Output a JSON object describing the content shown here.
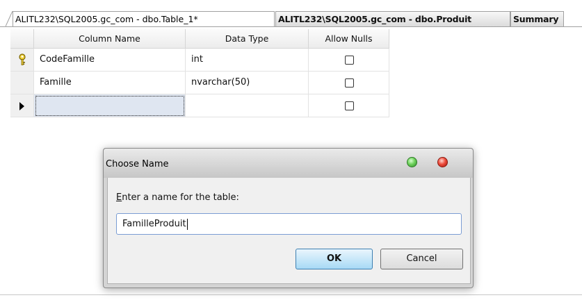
{
  "tabs": [
    {
      "label": "ALITL232\\SQL2005.gc_com - dbo.Table_1*",
      "active": true
    },
    {
      "label": "ALITL232\\SQL2005.gc_com - dbo.Produit",
      "active": false
    },
    {
      "label": "Summary",
      "active": false
    }
  ],
  "grid": {
    "headers": {
      "column_name": "Column Name",
      "data_type": "Data Type",
      "allow_nulls": "Allow Nulls"
    },
    "rows": [
      {
        "column_name": "CodeFamille",
        "data_type": "int",
        "allow_nulls": false,
        "primary_key": true
      },
      {
        "column_name": "Famille",
        "data_type": "nvarchar(50)",
        "allow_nulls": false,
        "primary_key": false
      },
      {
        "column_name": "",
        "data_type": "",
        "allow_nulls": false,
        "primary_key": false,
        "current": true
      }
    ]
  },
  "dialog": {
    "title": "Choose Name",
    "prompt_accel": "E",
    "prompt_rest": "nter a name for the table:",
    "input_value": "FamilleProduit",
    "ok_label": "OK",
    "cancel_label": "Cancel"
  },
  "icons": {
    "primary_key": "key-icon",
    "current_row": "row-pointer-icon",
    "window_minimize": "green-orb-icon",
    "window_close": "red-orb-icon"
  },
  "colors": {
    "ok_button": "#a7d9f5",
    "close_orb": "#ee4c3c",
    "minimize_orb": "#6fd25c"
  }
}
